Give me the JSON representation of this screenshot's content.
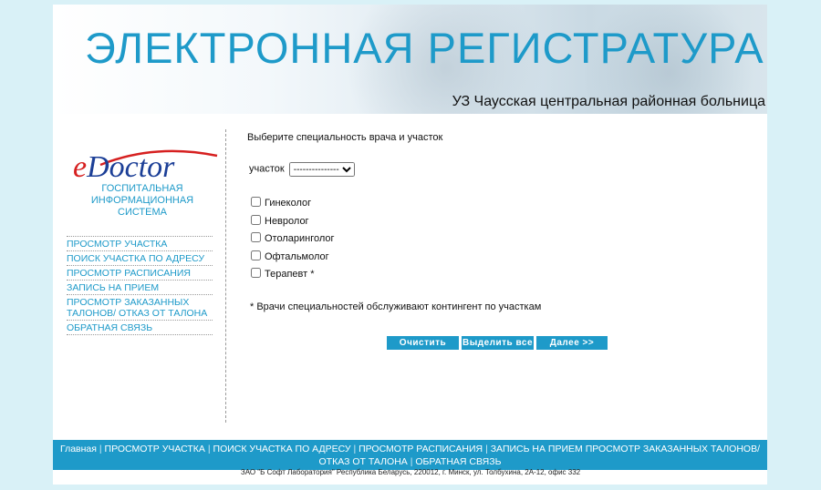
{
  "banner": {
    "title": "ЭЛЕКТРОННАЯ РЕГИСТРАТУРА",
    "subtitle": "УЗ Чаусская центральная районная больница"
  },
  "sidebar": {
    "logo_e": "e",
    "logo_rest": "Doctor",
    "system_name": "ГОСПИТАЛЬНАЯ ИНФОРМАЦИОННАЯ СИСТЕМА",
    "menu": [
      {
        "label": "ПРОСМОТР УЧАСТКА"
      },
      {
        "label": "ПОИСК УЧАСТКА ПО АДРЕСУ"
      },
      {
        "label": "ПРОСМОТР РАСПИСАНИЯ"
      },
      {
        "label": "ЗАПИСЬ НА ПРИЕМ"
      },
      {
        "label": "ПРОСМОТР ЗАКАЗАННЫХ ТАЛОНОВ/ ОТКАЗ ОТ ТАЛОНА"
      },
      {
        "label": "ОБРАТНАЯ СВЯЗЬ"
      }
    ]
  },
  "main": {
    "prompt": "Выберите специальность врача и участок",
    "district_label": "участок",
    "district_value": "---------------",
    "specialties": [
      {
        "label": "Гинеколог",
        "checked": false
      },
      {
        "label": "Невролог",
        "checked": false
      },
      {
        "label": "Отоларинголог",
        "checked": false
      },
      {
        "label": "Офтальмолог",
        "checked": false
      },
      {
        "label": "Терапевт *",
        "checked": false
      }
    ],
    "note": "* Врачи специальностей обслуживают контингент по участкам",
    "buttons": {
      "clear": "Очистить",
      "select_all": "Выделить все",
      "next": "Далее >>"
    }
  },
  "bottom_nav": {
    "home": "Главная",
    "view_district": "ПРОСМОТР УЧАСТКА",
    "search_district": "ПОИСК УЧАСТКА ПО АДРЕСУ",
    "view_schedule": "ПРОСМОТР РАСПИСАНИЯ",
    "appointment_and_tickets": "ЗАПИСЬ НА ПРИЕМ ПРОСМОТР ЗАКАЗАННЫХ ТАЛОНОВ/ ОТКАЗ ОТ ТАЛОНА",
    "feedback": "ОБРАТНАЯ СВЯЗЬ",
    "separator": "|"
  },
  "footer": {
    "text": "ЗАО \"Б Софт Лаборатория\" Республика Беларусь, 220012, г. Минск, ул. Толбухина, 2А-12, офис 332"
  },
  "colors": {
    "accent": "#1e9ac9",
    "background": "#d9f1f7",
    "logo_blue": "#1c3f97",
    "logo_red": "#d62020"
  }
}
